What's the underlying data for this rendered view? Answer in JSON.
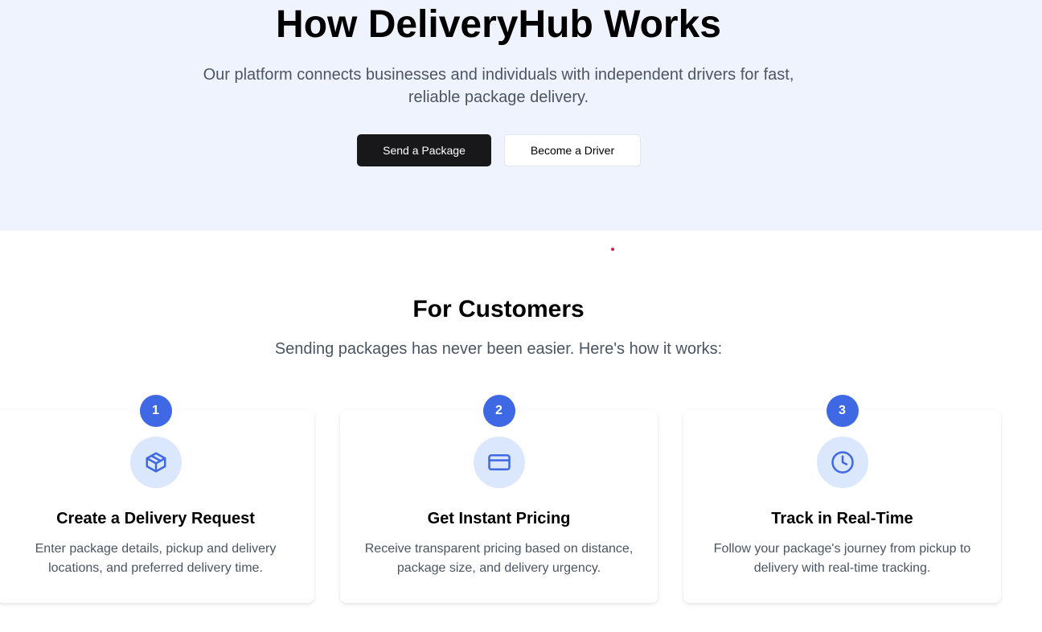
{
  "hero": {
    "title": "How DeliveryHub Works",
    "subtitle": "Our platform connects businesses and individuals with independent drivers for fast, reliable package delivery.",
    "primary_button": "Send a Package",
    "secondary_button": "Become a Driver"
  },
  "customers": {
    "title": "For Customers",
    "subtitle": "Sending packages has never been easier. Here's how it works:",
    "steps": [
      {
        "number": "1",
        "icon": "package-icon",
        "title": "Create a Delivery Request",
        "description": "Enter package details, pickup and delivery locations, and preferred delivery time."
      },
      {
        "number": "2",
        "icon": "credit-card-icon",
        "title": "Get Instant Pricing",
        "description": "Receive transparent pricing based on distance, package size, and delivery urgency."
      },
      {
        "number": "3",
        "icon": "clock-icon",
        "title": "Track in Real-Time",
        "description": "Follow your package's journey from pickup to delivery with real-time tracking."
      }
    ]
  },
  "colors": {
    "hero_background": "#eef3fe",
    "accent": "#3f68e4",
    "icon_circle": "#dbe7fd",
    "primary_button": "#18181b",
    "muted_text": "#4b5563",
    "cursor_dot": "#e11d48"
  }
}
